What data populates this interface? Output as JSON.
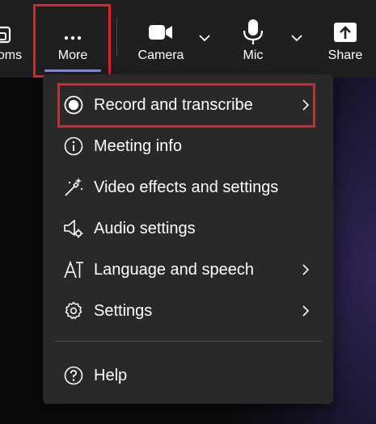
{
  "toolbar": {
    "rooms_label": "oms",
    "more_label": "More",
    "camera_label": "Camera",
    "mic_label": "Mic",
    "share_label": "Share"
  },
  "menu": {
    "items": [
      {
        "label": "Record and transcribe",
        "icon": "record-icon",
        "has_submenu": true
      },
      {
        "label": "Meeting info",
        "icon": "info-icon",
        "has_submenu": false
      },
      {
        "label": "Video effects and settings",
        "icon": "video-effects-icon",
        "has_submenu": false
      },
      {
        "label": "Audio settings",
        "icon": "audio-settings-icon",
        "has_submenu": false
      },
      {
        "label": "Language and speech",
        "icon": "language-icon",
        "has_submenu": true
      },
      {
        "label": "Settings",
        "icon": "gear-icon",
        "has_submenu": true
      },
      {
        "label": "Help",
        "icon": "help-icon",
        "has_submenu": false
      }
    ]
  },
  "colors": {
    "toolbar_bg": "#1f1f1f",
    "menu_bg": "#292929",
    "highlight": "#e2202c",
    "accent_underline": "#8b8fd6"
  }
}
